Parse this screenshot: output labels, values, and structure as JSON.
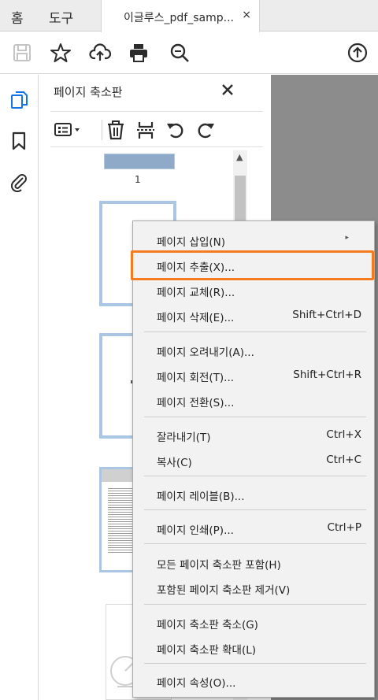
{
  "tabs": {
    "home": "홈",
    "tools": "도구",
    "document": "이글루스_pdf_samp...",
    "close": "×"
  },
  "toolbar": {
    "icons": [
      "save-icon",
      "star-icon",
      "cloud-upload-icon",
      "print-icon",
      "zoom-icon",
      "upload-icon"
    ]
  },
  "nav_rail": {
    "icons": [
      "page-thumbnails-icon",
      "bookmark-icon",
      "attachment-icon"
    ]
  },
  "panel": {
    "title": "페이지 축소판",
    "close": "✕",
    "page1_label": "1"
  },
  "context_menu": {
    "items": [
      {
        "label": "페이지 삽입(N)",
        "shortcut": "",
        "submenu": "▸"
      },
      {
        "label": "페이지 추출(X)...",
        "shortcut": ""
      },
      {
        "label": "페이지 교체(R)...",
        "shortcut": ""
      },
      {
        "label": "페이지 삭제(E)...",
        "shortcut": "Shift+Ctrl+D"
      },
      {
        "label": "페이지 오려내기(A)...",
        "shortcut": ""
      },
      {
        "label": "페이지 회전(T)...",
        "shortcut": "Shift+Ctrl+R"
      },
      {
        "label": "페이지 전환(S)...",
        "shortcut": ""
      },
      {
        "label": "잘라내기(T)",
        "shortcut": "Ctrl+X"
      },
      {
        "label": "복사(C)",
        "shortcut": "Ctrl+C"
      },
      {
        "label": "페이지 레이블(B)...",
        "shortcut": ""
      },
      {
        "label": "페이지 인쇄(P)...",
        "shortcut": "Ctrl+P"
      },
      {
        "label": "모든 페이지 축소판 포함(H)",
        "shortcut": ""
      },
      {
        "label": "포함된 페이지 축소판 제거(V)",
        "shortcut": ""
      },
      {
        "label": "페이지 축소판 축소(G)",
        "shortcut": ""
      },
      {
        "label": "페이지 축소판 확대(L)",
        "shortcut": ""
      },
      {
        "label": "페이지 속성(O)...",
        "shortcut": ""
      }
    ],
    "highlight_color": "#f47b20"
  }
}
